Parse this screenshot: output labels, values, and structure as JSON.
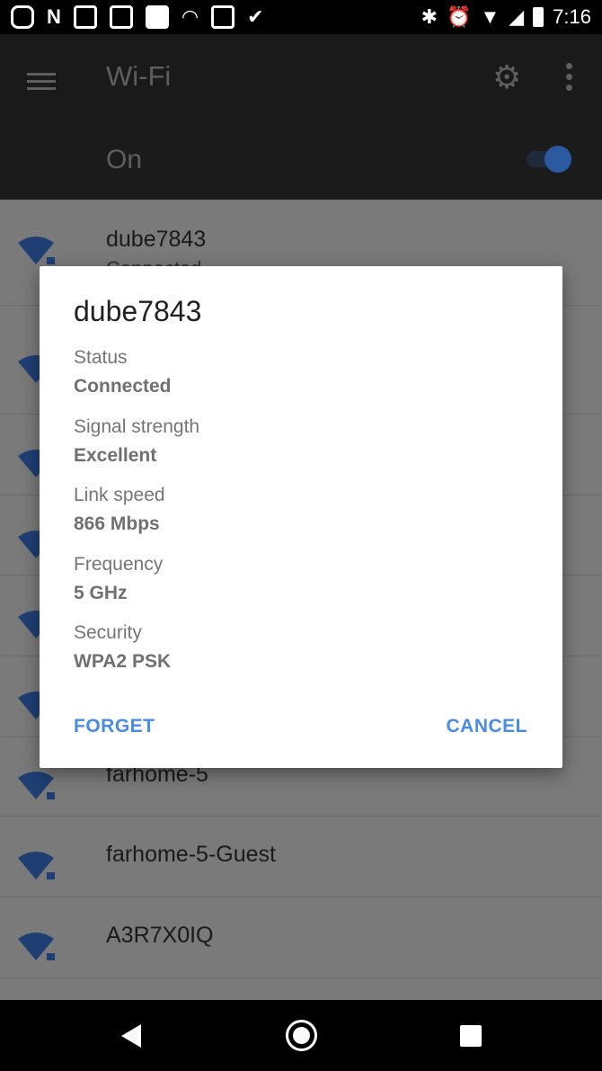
{
  "status_bar": {
    "time": "7:16",
    "left_icons": [
      "notification-circle-icon",
      "netflix-icon",
      "gmail-icon",
      "news-icon",
      "photos-icon",
      "wifi-icon",
      "gallery-icon",
      "task-icon"
    ],
    "right_icons": [
      "bluetooth-icon",
      "alarm-icon",
      "wifi-signal-icon",
      "cell-signal-icon",
      "battery-icon"
    ]
  },
  "app_bar": {
    "title": "Wi-Fi"
  },
  "wifi_toggle": {
    "label": "On",
    "state": true,
    "accent": "#2c5aa0"
  },
  "networks": [
    {
      "name": "dube7843",
      "sub": "Connected",
      "locked": true
    },
    {
      "name": "",
      "locked": false
    },
    {
      "name": "",
      "locked": false
    },
    {
      "name": "",
      "locked": false
    },
    {
      "name": "",
      "locked": false
    },
    {
      "name": "",
      "locked": false
    },
    {
      "name": "farhome-5",
      "locked": true
    },
    {
      "name": "farhome-5-Guest",
      "locked": true
    },
    {
      "name": "A3R7X0IQ",
      "locked": true
    }
  ],
  "dialog": {
    "title": "dube7843",
    "fields": [
      {
        "label": "Status",
        "value": "Connected"
      },
      {
        "label": "Signal strength",
        "value": "Excellent"
      },
      {
        "label": "Link speed",
        "value": "866 Mbps"
      },
      {
        "label": "Frequency",
        "value": "5 GHz"
      },
      {
        "label": "Security",
        "value": "WPA2 PSK"
      }
    ],
    "forget_label": "FORGET",
    "cancel_label": "CANCEL",
    "button_color": "#4a8de0"
  }
}
